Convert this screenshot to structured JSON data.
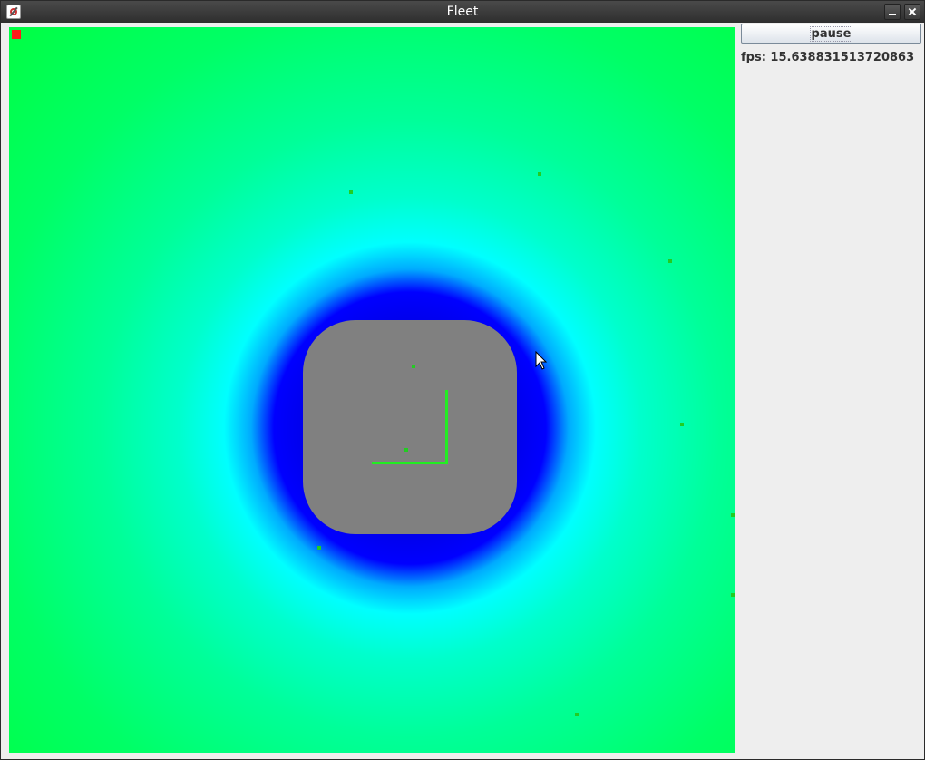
{
  "window": {
    "title": "Fleet",
    "controls": {
      "minimize_icon": "minimize-icon",
      "close_icon": "close-icon"
    }
  },
  "controls": {
    "pause_label": "pause",
    "fps_text": "fps: 15.638831513720863"
  },
  "simulation": {
    "obstacle_color": "#808080",
    "field_colors": [
      "#0000ff",
      "#00ffff",
      "#00ff55"
    ],
    "agent_color": "#22cc22",
    "path_color": "#22ee22",
    "marker_color": "#ff1a1a"
  }
}
